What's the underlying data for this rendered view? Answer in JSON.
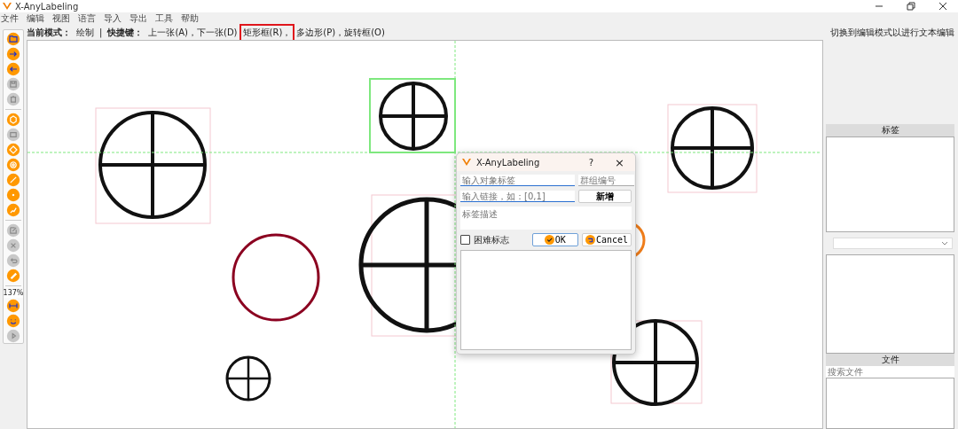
{
  "window": {
    "title": "X-AnyLabeling"
  },
  "menu": [
    "文件",
    "编辑",
    "视图",
    "语言",
    "导入",
    "导出",
    "工具",
    "帮助"
  ],
  "mode_bar": [
    {
      "kind": "key",
      "text": "当前模式："
    },
    {
      "kind": "text",
      "text": "绘制"
    },
    {
      "kind": "sep",
      "text": "|"
    },
    {
      "kind": "key",
      "text": "快捷键："
    },
    {
      "kind": "text",
      "text": "上一张(A)，下一张(D)"
    },
    {
      "kind": "mark",
      "text": "矩形框(R)，"
    },
    {
      "kind": "text",
      "text": "多边形(P)，旋转框(O)"
    }
  ],
  "tools": [
    {
      "kind": "icon",
      "disabled": false
    },
    {
      "kind": "icon",
      "disabled": false
    },
    {
      "kind": "icon",
      "disabled": false
    },
    {
      "kind": "icon",
      "disabled": true
    },
    {
      "kind": "icon",
      "disabled": true
    },
    {
      "kind": "separator"
    },
    {
      "kind": "icon",
      "disabled": false
    },
    {
      "kind": "icon",
      "disabled": true
    },
    {
      "kind": "icon",
      "disabled": false
    },
    {
      "kind": "icon",
      "disabled": false
    },
    {
      "kind": "icon",
      "disabled": false
    },
    {
      "kind": "icon",
      "disabled": false
    },
    {
      "kind": "icon",
      "disabled": false
    },
    {
      "kind": "separator"
    },
    {
      "kind": "icon",
      "disabled": true
    },
    {
      "kind": "icon",
      "disabled": true
    },
    {
      "kind": "icon",
      "disabled": true
    },
    {
      "kind": "icon",
      "disabled": false
    },
    {
      "kind": "separator"
    },
    {
      "kind": "zoom",
      "label": "137%"
    },
    {
      "kind": "icon",
      "disabled": false
    },
    {
      "kind": "icon",
      "disabled": false
    },
    {
      "kind": "icon",
      "disabled": true
    }
  ],
  "dialog": {
    "title": "X-AnyLabeling",
    "help": "?",
    "close": "×",
    "label_placeholder": "输入对象标签",
    "group_placeholder": "群组编号",
    "link_placeholder": "输入链接，如：[0,1]",
    "add_button": "新增",
    "description_placeholder": "标签描述",
    "difficult": {
      "label": "困难标志",
      "checked": false
    },
    "ok": "OK",
    "cancel": "Cancel"
  },
  "right_panel": {
    "hint": "切换到编辑模式以进行文本编辑",
    "labels_header": "标签",
    "files_header": "文件",
    "file_search_placeholder": "搜索文件"
  }
}
